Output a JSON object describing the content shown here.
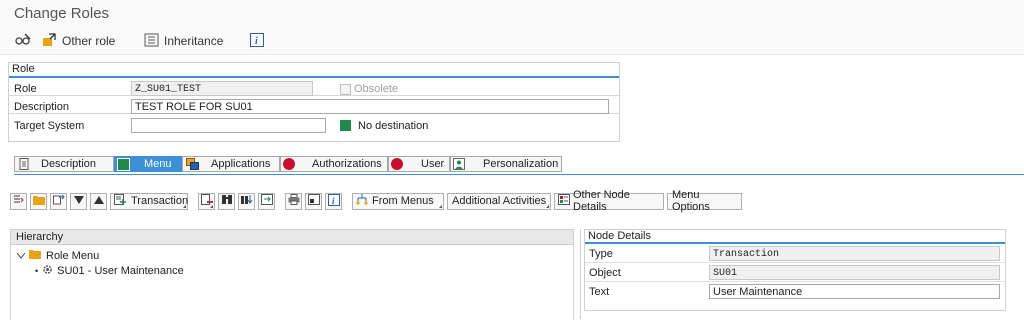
{
  "window": {
    "title": "Change Roles"
  },
  "toolbar1": {
    "other_role": "Other role",
    "inheritance": "Inheritance"
  },
  "role_group": {
    "title": "Role",
    "role_label": "Role",
    "role_value": "Z_SU01_TEST",
    "obsolete_label": "Obsolete",
    "description_label": "Description",
    "description_value": "TEST ROLE FOR SU01",
    "target_system_label": "Target System",
    "target_system_value": "",
    "no_destination": "No destination"
  },
  "tabs": [
    {
      "label": "Description"
    },
    {
      "label": "Menu"
    },
    {
      "label": "Applications"
    },
    {
      "label": "Authorizations"
    },
    {
      "label": "User"
    },
    {
      "label": "Personalization"
    }
  ],
  "menu_toolbar": {
    "transaction": "Transaction",
    "from_menus": "From Menus",
    "additional_activities": "Additional Activities",
    "other_node_details": "Other Node Details",
    "menu_options": "Menu Options"
  },
  "hierarchy": {
    "header": "Hierarchy",
    "root": "Role Menu",
    "child": "SU01 - User Maintenance"
  },
  "node_details": {
    "header": "Node Details",
    "type_label": "Type",
    "type_value": "Transaction",
    "object_label": "Object",
    "object_value": "SU01",
    "text_label": "Text",
    "text_value": "User Maintenance"
  },
  "colors": {
    "accent": "#3d8fd6",
    "status_green": "#1f8a4c",
    "status_red": "#c8102e"
  }
}
